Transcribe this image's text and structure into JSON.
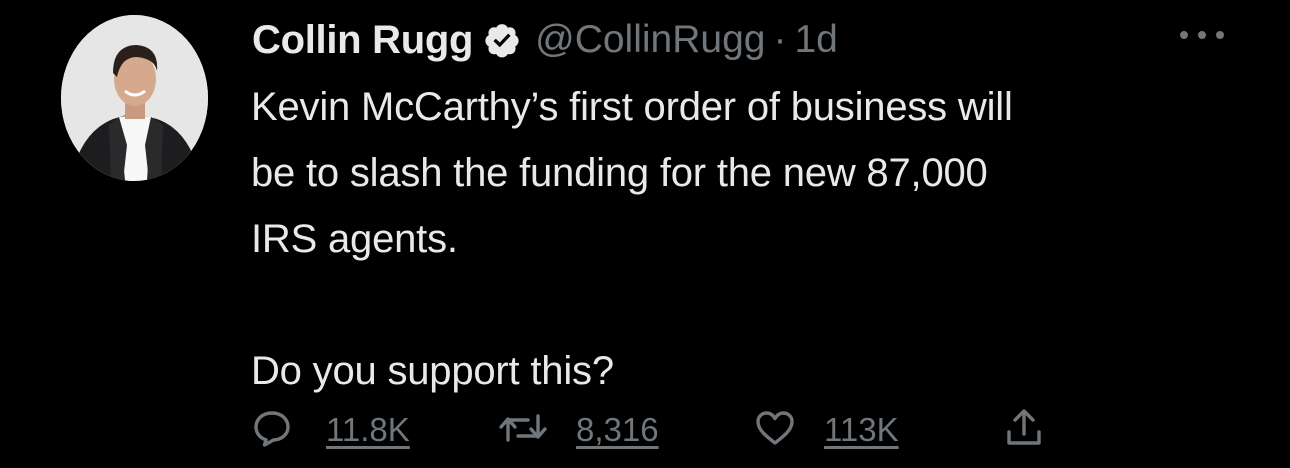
{
  "tweet": {
    "author_name": "Collin Rugg",
    "handle": "@CollinRugg",
    "separator": "·",
    "time": "1d",
    "text": "Kevin McCarthy’s first order of business will\nbe to slash the funding for the new 87,000\nIRS agents.\n\nDo you support this?",
    "reply_count": "11.8K",
    "retweet_count": "8,316",
    "like_count": "113K"
  },
  "icons": {
    "verified": "verified-badge-icon",
    "more": "more-options-icon",
    "reply": "reply-icon",
    "retweet": "retweet-icon",
    "like": "like-icon",
    "share": "share-icon"
  },
  "colors": {
    "background": "#000000",
    "primary_text": "#e7e9ea",
    "secondary_text": "#71767b"
  }
}
